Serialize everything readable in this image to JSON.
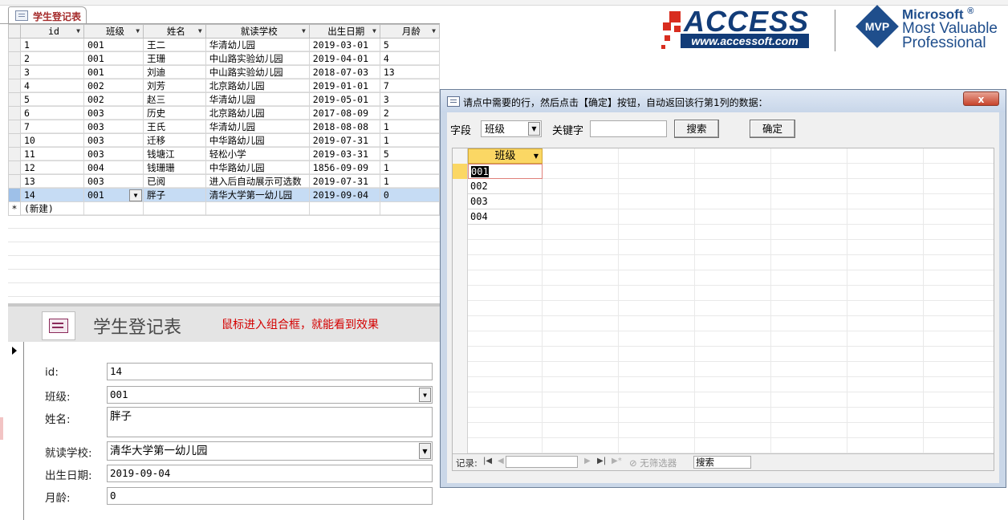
{
  "document_tab": {
    "label": "学生登记表"
  },
  "datasheet": {
    "columns": [
      "id",
      "班级",
      "姓名",
      "就读学校",
      "出生日期",
      "月龄"
    ],
    "rows": [
      [
        "1",
        "001",
        "王二",
        "华清幼儿园",
        "2019-03-01",
        "5"
      ],
      [
        "2",
        "001",
        "王珊",
        "中山路实验幼儿园",
        "2019-04-01",
        "4"
      ],
      [
        "3",
        "001",
        "刘迪",
        "中山路实验幼儿园",
        "2018-07-03",
        "13"
      ],
      [
        "4",
        "002",
        "刘芳",
        "北京路幼儿园",
        "2019-01-01",
        "7"
      ],
      [
        "5",
        "002",
        "赵三",
        "华清幼儿园",
        "2019-05-01",
        "3"
      ],
      [
        "6",
        "003",
        "历史",
        "北京路幼儿园",
        "2017-08-09",
        "2"
      ],
      [
        "7",
        "003",
        "王氏",
        "华清幼儿园",
        "2018-08-08",
        "1"
      ],
      [
        "10",
        "003",
        "迁移",
        "中华路幼儿园",
        "2019-07-31",
        "1"
      ],
      [
        "11",
        "003",
        "钱塘江",
        "轻松小学",
        "2019-03-31",
        "5"
      ],
      [
        "12",
        "004",
        "钱珊珊",
        "中华路幼儿园",
        "1856-09-09",
        "1"
      ],
      [
        "13",
        "003",
        "已阅",
        "进入后自动展示可选数",
        "2019-07-31",
        "1"
      ],
      [
        "14",
        "001",
        "胖子",
        "清华大学第一幼儿园",
        "2019-09-04",
        "0"
      ]
    ],
    "new_row_marker": "*",
    "new_row_label": "(新建)"
  },
  "logo": {
    "access_word": "ACCESS",
    "access_url": "www.accessoft.com",
    "mvp_badge": "MVP",
    "ms_line1": "Microsoft",
    "ms_reg": "®",
    "ms_line2": "Most Valuable",
    "ms_line3": "Professional"
  },
  "form": {
    "title": "学生登记表",
    "hint": "鼠标进入组合框，就能看到效果",
    "fields": {
      "id_label": "id:",
      "id_value": "14",
      "class_label": "班级:",
      "class_value": "001",
      "name_label": "姓名:",
      "name_value": "胖子",
      "school_label": "就读学校:",
      "school_value": "清华大学第一幼儿园",
      "birth_label": "出生日期:",
      "birth_value": "2019-09-04",
      "age_label": "月龄:",
      "age_value": "0"
    }
  },
  "dialog": {
    "title": "请点中需要的行，然后点击【确定】按钮，自动返回该行第1列的数据：",
    "close_glyph": "x",
    "field_label": "字段",
    "field_value": "班级",
    "keyword_label": "关键字",
    "keyword_value": "",
    "search_button": "搜索",
    "ok_button": "确定",
    "list_header": "班级",
    "list_values": [
      "001",
      "002",
      "003",
      "004"
    ],
    "nav": {
      "record_label": "记录:",
      "filter_label": "无筛选器",
      "search_text": "搜索"
    }
  },
  "colors": {
    "tab_text": "#a42a2a",
    "current_row": "#c6dcf4",
    "hint_text": "#d40000",
    "subform_header": "#fbd764",
    "dialog_frame": "#cad7e8",
    "close_button": "#c7432b"
  },
  "icons": [
    "table-icon",
    "form-icon",
    "dropdown-arrow-icon",
    "record-selector-icon",
    "nav-first-icon",
    "nav-prev-icon",
    "nav-next-icon",
    "nav-last-icon",
    "filter-icon"
  ]
}
